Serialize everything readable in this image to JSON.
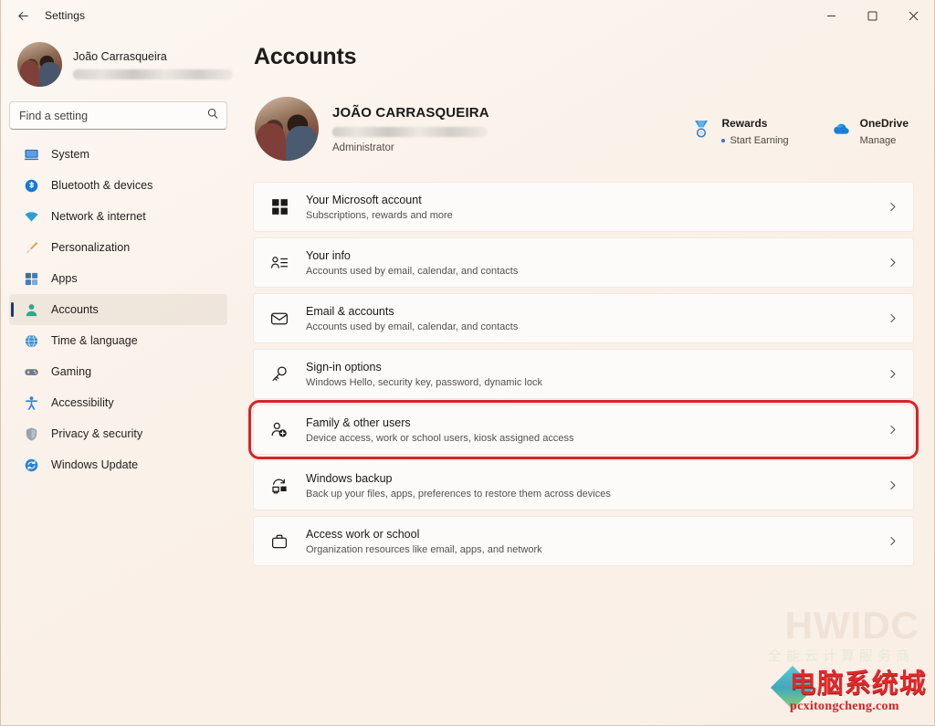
{
  "titlebar": {
    "back_icon": "back-arrow-icon",
    "title": "Settings",
    "minimize_label": "Minimize",
    "maximize_label": "Maximize",
    "close_label": "Close"
  },
  "sidebar": {
    "profile": {
      "name": "João Carrasqueira",
      "email_redacted": true,
      "avatar_icon": "user-avatar"
    },
    "search": {
      "placeholder": "Find a setting",
      "value": "",
      "icon": "search-icon"
    },
    "items": [
      {
        "label": "System",
        "icon": "display-icon",
        "selected": false
      },
      {
        "label": "Bluetooth & devices",
        "icon": "bluetooth-icon",
        "selected": false
      },
      {
        "label": "Network & internet",
        "icon": "wifi-icon",
        "selected": false
      },
      {
        "label": "Personalization",
        "icon": "paintbrush-icon",
        "selected": false
      },
      {
        "label": "Apps",
        "icon": "apps-icon",
        "selected": false
      },
      {
        "label": "Accounts",
        "icon": "person-icon",
        "selected": true
      },
      {
        "label": "Time & language",
        "icon": "clock-globe-icon",
        "selected": false
      },
      {
        "label": "Gaming",
        "icon": "gamepad-icon",
        "selected": false
      },
      {
        "label": "Accessibility",
        "icon": "accessibility-icon",
        "selected": false
      },
      {
        "label": "Privacy & security",
        "icon": "shield-icon",
        "selected": false
      },
      {
        "label": "Windows Update",
        "icon": "update-icon",
        "selected": false
      }
    ]
  },
  "main": {
    "page_title": "Accounts",
    "account": {
      "name": "JOÃO CARRASQUEIRA",
      "email_redacted": true,
      "role": "Administrator",
      "avatar_icon": "user-avatar"
    },
    "quick_links": [
      {
        "title": "Rewards",
        "subtitle": "Start Earning",
        "icon": "rewards-medal-icon",
        "has_dot": true
      },
      {
        "title": "OneDrive",
        "subtitle": "Manage",
        "icon": "onedrive-cloud-icon",
        "has_dot": false
      }
    ],
    "cards": [
      {
        "title": "Your Microsoft account",
        "subtitle": "Subscriptions, rewards and more",
        "icon": "microsoft-logo-icon",
        "chevron": "chevron-right-icon",
        "highlighted": false
      },
      {
        "title": "Your info",
        "subtitle": "Accounts used by email, calendar, and contacts",
        "icon": "user-info-icon",
        "chevron": "chevron-right-icon",
        "highlighted": false
      },
      {
        "title": "Email & accounts",
        "subtitle": "Accounts used by email, calendar, and contacts",
        "icon": "envelope-icon",
        "chevron": "chevron-right-icon",
        "highlighted": false
      },
      {
        "title": "Sign-in options",
        "subtitle": "Windows Hello, security key, password, dynamic lock",
        "icon": "key-icon",
        "chevron": "chevron-right-icon",
        "highlighted": false
      },
      {
        "title": "Family & other users",
        "subtitle": "Device access, work or school users, kiosk assigned access",
        "icon": "add-user-icon",
        "chevron": "chevron-right-icon",
        "highlighted": true
      },
      {
        "title": "Windows backup",
        "subtitle": "Back up your files, apps, preferences to restore them across devices",
        "icon": "backup-sync-icon",
        "chevron": "chevron-right-icon",
        "highlighted": false
      },
      {
        "title": "Access work or school",
        "subtitle": "Organization resources like email, apps, and network",
        "icon": "briefcase-icon",
        "chevron": "chevron-right-icon",
        "highlighted": false
      }
    ]
  },
  "watermarks": {
    "brand_latin": "HWIDC",
    "brand_sub": "全能云计算服务商",
    "logo_cn": "电脑系统城",
    "logo_url": "pcxitongcheng.com"
  },
  "colors": {
    "window_bg": "#faf1e9",
    "card_bg": "#fdfbfa",
    "accent_selected": "#1f3864",
    "highlight_ring": "#d6242a",
    "brand_red": "#e2282a"
  }
}
